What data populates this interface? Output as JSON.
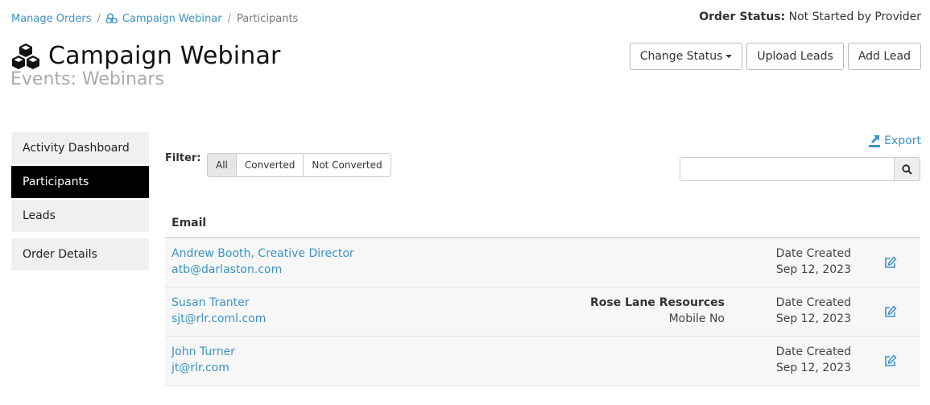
{
  "breadcrumb": {
    "items": [
      {
        "label": "Manage Orders"
      },
      {
        "label": "Campaign Webinar",
        "icon": "cubes-icon"
      },
      {
        "label": "Participants"
      }
    ]
  },
  "order_status": {
    "label": "Order Status:",
    "value": "Not Started by Provider"
  },
  "header": {
    "title": "Campaign Webinar",
    "subtitle": "Events: Webinars",
    "icon": "cubes-icon"
  },
  "actions": {
    "change_status": "Change Status",
    "upload_leads": "Upload Leads",
    "add_lead": "Add Lead"
  },
  "sidebar": {
    "items": [
      {
        "label": "Activity Dashboard",
        "active": false
      },
      {
        "label": "Participants",
        "active": true
      },
      {
        "label": "Leads",
        "active": false
      },
      {
        "label": "Order Details",
        "active": false
      }
    ]
  },
  "filter": {
    "label": "Filter:",
    "options": [
      "All",
      "Converted",
      "Not Converted"
    ],
    "selected": "All"
  },
  "export": {
    "label": "Export",
    "icon": "export-icon"
  },
  "search": {
    "placeholder": "",
    "value": "",
    "icon": "search-icon"
  },
  "table": {
    "header": "Email",
    "rows": [
      {
        "name": "Andrew Booth, Creative Director",
        "email": "atb@darlaston.com",
        "company": "",
        "phone": "",
        "date_label": "Date Created",
        "date": "Sep 12, 2023"
      },
      {
        "name": "Susan Tranter",
        "email": "sjt@rlr.coml.com",
        "company": "Rose Lane Resources",
        "phone": "Mobile No",
        "date_label": "Date Created",
        "date": "Sep 12, 2023"
      },
      {
        "name": "John Turner",
        "email": "jt@rlr.com",
        "company": "",
        "phone": "",
        "date_label": "Date Created",
        "date": "Sep 12, 2023"
      }
    ]
  },
  "colors": {
    "link": "#3a92c9",
    "active_nav": "#000000",
    "nav_bg": "#f0f0f0"
  }
}
